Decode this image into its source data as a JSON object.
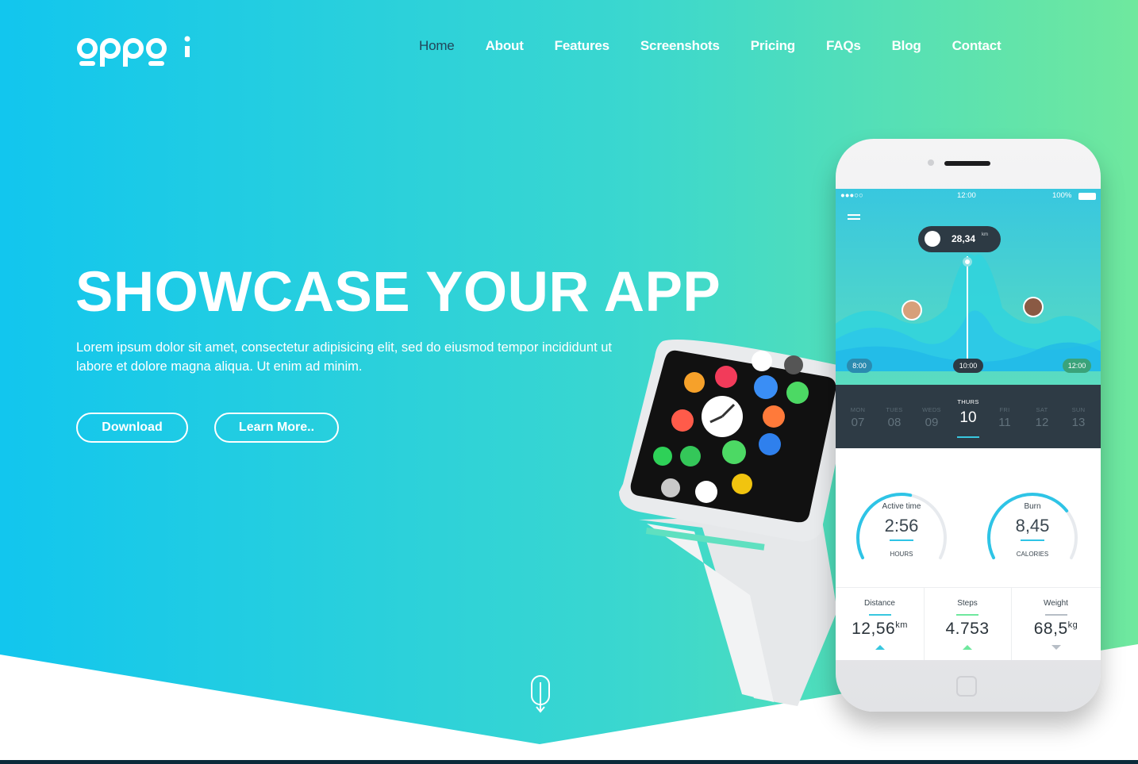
{
  "brand": {
    "logo_text": "oppoi"
  },
  "nav": {
    "items": [
      {
        "label": "Home",
        "active": true
      },
      {
        "label": "About"
      },
      {
        "label": "Features"
      },
      {
        "label": "Screenshots"
      },
      {
        "label": "Pricing"
      },
      {
        "label": "FAQs"
      },
      {
        "label": "Blog"
      },
      {
        "label": "Contact"
      }
    ]
  },
  "hero": {
    "title": "SHOWCASE YOUR APP",
    "text": "Lorem ipsum dolor sit amet, consectetur adipisicing elit, sed do eiusmod tempor incididunt ut labore et dolore magna aliqua. Ut enim ad minim.",
    "download_label": "Download",
    "learn_label": "Learn More..",
    "scroll_icon": "mouse-scroll-icon"
  },
  "colors": {
    "gradient_left": "#12c6ee",
    "gradient_right": "#6fe89e",
    "nav_active": "#22465a",
    "dark_panel": "#2e3b45"
  },
  "phone": {
    "status": {
      "carrier": "●●●○○",
      "time": "12:00",
      "battery": "100%"
    },
    "bubble": {
      "value": "28,34",
      "unit": "km"
    },
    "timeline": {
      "start": "8:00",
      "mid": "10:00",
      "end": "12:00"
    },
    "days": [
      {
        "name": "MON",
        "num": "07"
      },
      {
        "name": "TUES",
        "num": "08"
      },
      {
        "name": "WEDS",
        "num": "09"
      },
      {
        "name": "THURS",
        "num": "10",
        "active": true
      },
      {
        "name": "FRI",
        "num": "11"
      },
      {
        "name": "SAT",
        "num": "12"
      },
      {
        "name": "SUN",
        "num": "13"
      }
    ],
    "active_time": {
      "label": "Active time",
      "value": "2:56",
      "unit": "HOURS",
      "fraction": 0.55
    },
    "burn": {
      "label": "Burn",
      "value": "8,45",
      "unit": "CALORIES",
      "fraction": 0.72
    },
    "stats": [
      {
        "label": "Distance",
        "value": "12,56",
        "unit": "km",
        "color": "#38c7df"
      },
      {
        "label": "Steps",
        "value": "4.753",
        "unit": "",
        "color": "#6fe89e"
      },
      {
        "label": "Weight",
        "value": "68,5",
        "unit": "kg",
        "color": "#b7bec6"
      }
    ]
  }
}
